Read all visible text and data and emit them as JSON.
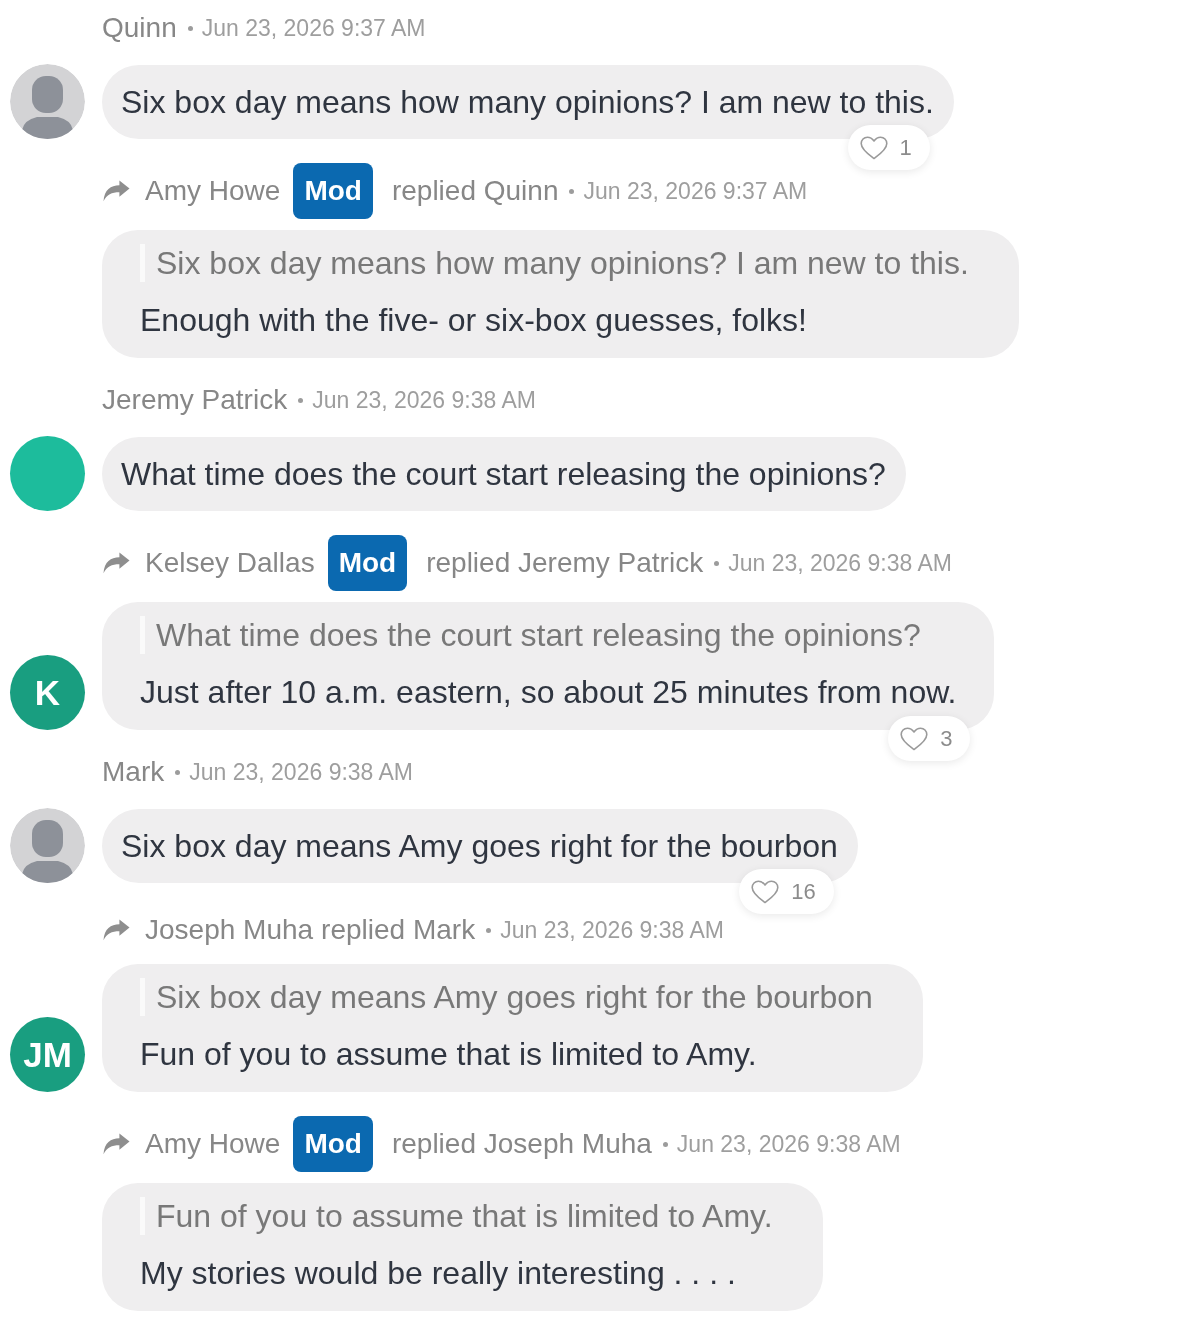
{
  "messages": [
    {
      "kind": "post",
      "author": "Quinn",
      "time": "Jun 23, 2026 9:37 AM",
      "avatar": {
        "kind": "silhouette"
      },
      "text": "Six box day means how many opinions? I am new to this.",
      "likes": "1"
    },
    {
      "kind": "reply",
      "author": "Amy Howe",
      "badge": "Mod",
      "replied": "replied Quinn",
      "time": "Jun 23, 2026 9:37 AM",
      "quote": "Six box day means how many opinions? I am new to this.",
      "text": "Enough with the five- or six-box guesses, folks!"
    },
    {
      "kind": "post",
      "author": "Jeremy Patrick",
      "time": "Jun 23, 2026 9:38 AM",
      "avatar": {
        "kind": "plain",
        "color": "#1dbc9c"
      },
      "text": "What time does the court start releasing the opinions?"
    },
    {
      "kind": "reply",
      "author": "Kelsey Dallas",
      "badge": "Mod",
      "replied": "replied Jeremy Patrick",
      "time": "Jun 23, 2026 9:38 AM",
      "avatar": {
        "kind": "initials",
        "initials": "K",
        "color": "#199e80"
      },
      "quote": "What time does the court start releasing the opinions?",
      "text": "Just after 10 a.m. eastern, so about 25 minutes from now.",
      "likes": "3"
    },
    {
      "kind": "post",
      "author": "Mark",
      "time": "Jun 23, 2026 9:38 AM",
      "avatar": {
        "kind": "silhouette"
      },
      "text": "Six box day means Amy goes right for the bourbon",
      "likes": "16"
    },
    {
      "kind": "reply",
      "author": "Joseph Muha",
      "replied": "replied Mark",
      "time": "Jun 23, 2026 9:38 AM",
      "avatar": {
        "kind": "initials",
        "initials": "JM",
        "color": "#199e80"
      },
      "quote": "Six box day means Amy goes right for the bourbon",
      "text": "Fun of you to assume that is limited to Amy."
    },
    {
      "kind": "reply",
      "author": "Amy Howe",
      "badge": "Mod",
      "replied": "replied Joseph Muha",
      "time": "Jun 23, 2026 9:38 AM",
      "quote": "Fun of you to assume that is limited to Amy.",
      "text": "My stories would be really interesting . . . ."
    }
  ]
}
